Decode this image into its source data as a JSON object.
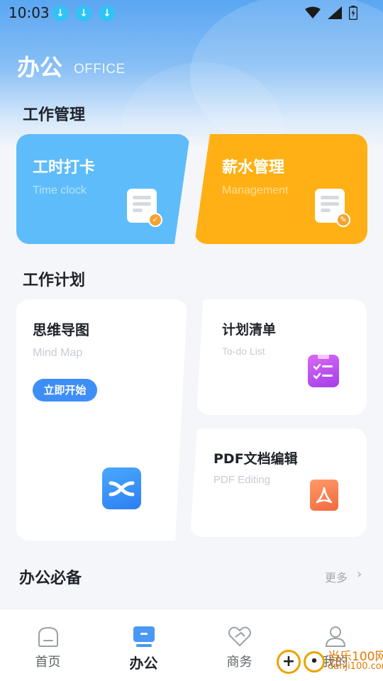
{
  "status": {
    "time": "10:03"
  },
  "header": {
    "title": "办公",
    "subtitle": "OFFICE"
  },
  "sections": {
    "work_mgmt": "工作管理",
    "work_plan": "工作计划",
    "essentials": "办公必备",
    "more": "更多"
  },
  "cards": {
    "timeclock": {
      "title": "工时打卡",
      "sub": "Time clock"
    },
    "salary": {
      "title": "薪水管理",
      "sub": "Management"
    },
    "mindmap": {
      "title": "思维导图",
      "sub": "Mind Map",
      "button": "立即开始"
    },
    "todo": {
      "title": "计划清单",
      "sub": "To-do List"
    },
    "pdf": {
      "title": "PDF文档编辑",
      "sub": "PDF Editing"
    }
  },
  "tabs": [
    {
      "label": "首页",
      "icon": "home-icon"
    },
    {
      "label": "办公",
      "icon": "office-icon",
      "active": true
    },
    {
      "label": "商务",
      "icon": "handshake-icon"
    },
    {
      "label": "我的",
      "icon": "user-icon"
    }
  ],
  "watermark": {
    "name": "当乐100网",
    "url": "danji100.com"
  },
  "colors": {
    "blue_card": "#5ebcfb",
    "orange_card": "#ffb014",
    "accent_button": "#3f8ef7",
    "background": "#f4f6fa"
  }
}
